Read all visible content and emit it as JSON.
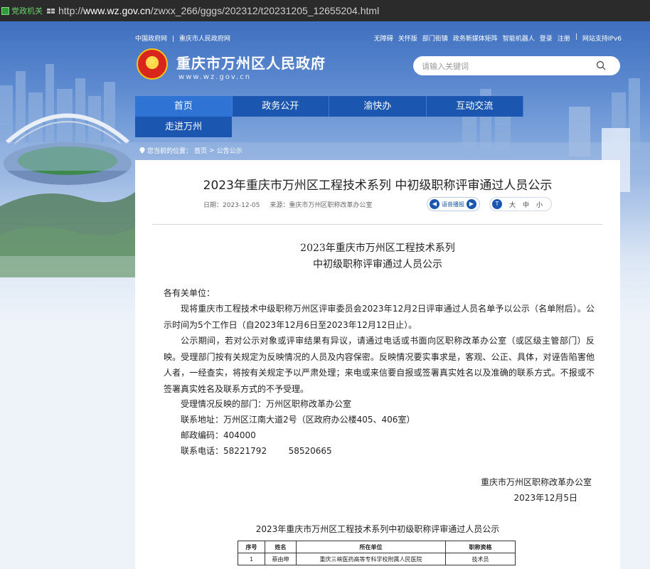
{
  "browser": {
    "badge": "党政机关",
    "url_prefix": "http://",
    "url_domain": "www.wz.gov.cn",
    "url_path": "/zwxx_266/gggs/202312/t20231205_12655204.html"
  },
  "header": {
    "left_links": [
      "中国政府网",
      "|",
      "重庆市人民政府网"
    ],
    "right_links": [
      "无障碍",
      "关怀版",
      "部门街镇",
      "政务新媒体矩阵",
      "智能机器人",
      "登录",
      "注册",
      "|",
      "网站支持IPv6"
    ],
    "site_title": "重庆市万州区人民政府",
    "site_domain": "www.wz.gov.cn",
    "search_placeholder": "请输入关键词"
  },
  "nav": {
    "items": [
      "首页",
      "政务公开",
      "渝快办",
      "互动交流"
    ],
    "second_row": "走进万州"
  },
  "breadcrumb": {
    "prefix": "您当前的位置：",
    "home": "首页",
    "separator": ">",
    "current": "公告公示"
  },
  "article": {
    "title": "2023年重庆市万州区工程技术系列 中初级职称评审通过人员公示",
    "date_label": "日期：2023-12-05",
    "source_label": "来源：重庆市万州区职称改革办公室",
    "voice_label": "语音播报",
    "font_sizes": [
      "大",
      "中",
      "小"
    ],
    "doc_title_1": "2023年重庆市万州区工程技术系列",
    "doc_title_2": "中初级职称评审通过人员公示",
    "salutation": "各有关单位：",
    "para1": "现将重庆市工程技术中级职称万州区评审委员会2023年12月2日评审通过人员名单予以公示（名单附后）。公示时间为5个工作日（自2023年12月6日至2023年12月12日止）。",
    "para2": "公示期间，若对公示对象或评审结果有异议，请通过电话或书面向区职称改革办公室（或区级主管部门）反映。受理部门按有关规定为反映情况的人员及内容保密。反映情况要实事求是，客观、公正、具体，对诬告陷害他人者，一经查实，将按有关规定予以严肃处理；来电或来信要自报或签署真实姓名以及准确的联系方式。不报或不签署真实姓名及联系方式的不予受理。",
    "contact_dept": "受理情况反映的部门：万州区职称改革办公室",
    "contact_addr": "联系地址：万州区江南大道2号（区政府办公楼405、406室）",
    "contact_zip": "邮政编码：404000",
    "contact_phone": "联系电话：58221792        58520665",
    "sign_org": "重庆市万州区职称改革办公室",
    "sign_date": "2023年12月5日",
    "table_title": "2023年重庆市万州区工程技术系列中初级职称评审通过人员公示",
    "table_headers": [
      "序号",
      "姓名",
      "所在单位",
      "职称资格"
    ],
    "table_rows": [
      [
        "1",
        "蔡由坤",
        "重庆三峡医药高等专科学校附属人民医院",
        "技术员"
      ]
    ]
  }
}
